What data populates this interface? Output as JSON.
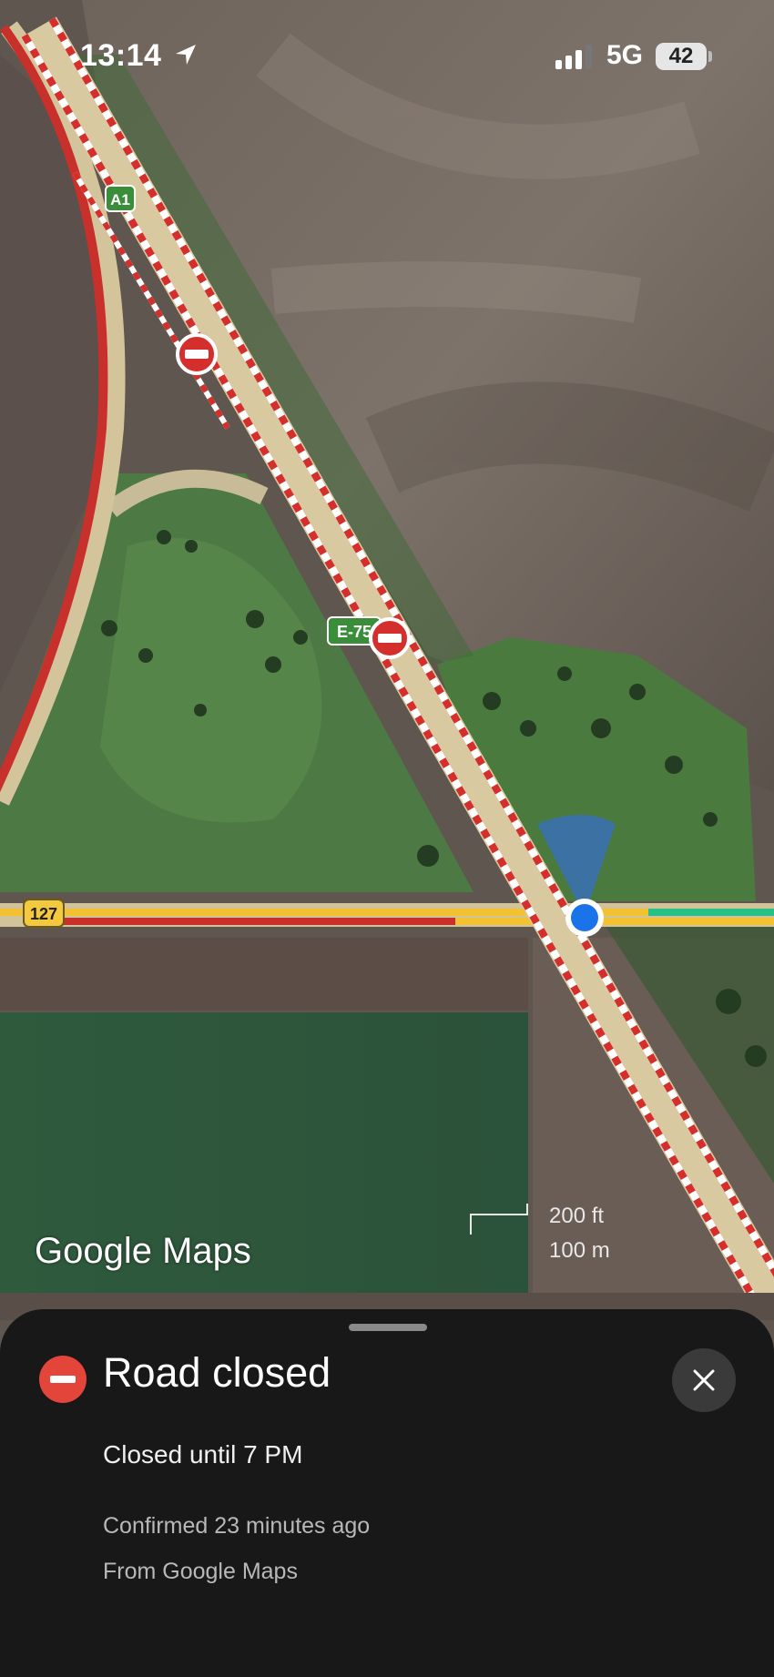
{
  "status_bar": {
    "time": "13:14",
    "network": "5G",
    "battery": "42",
    "location_icon": "location-arrow-icon",
    "signal_icon": "cellular-signal-icon"
  },
  "map": {
    "road_labels": {
      "a1": "A1",
      "e75": "E-75",
      "r127": "127"
    },
    "closure_icon": "no-entry-icon",
    "user_location_icon": "blue-dot-location-icon",
    "watermark": "Google Maps",
    "scale": {
      "ft": "200 ft",
      "m": "100 m"
    },
    "colors": {
      "closure_red": "#d42f2c",
      "road_yellow": "#f2c233",
      "traffic_green": "#27c188",
      "location_blue": "#1a73e8"
    }
  },
  "sheet": {
    "title": "Road closed",
    "detail": "Closed until 7 PM",
    "confirmed": "Confirmed 23 minutes ago",
    "source": "From Google Maps",
    "close_icon": "close-icon"
  }
}
